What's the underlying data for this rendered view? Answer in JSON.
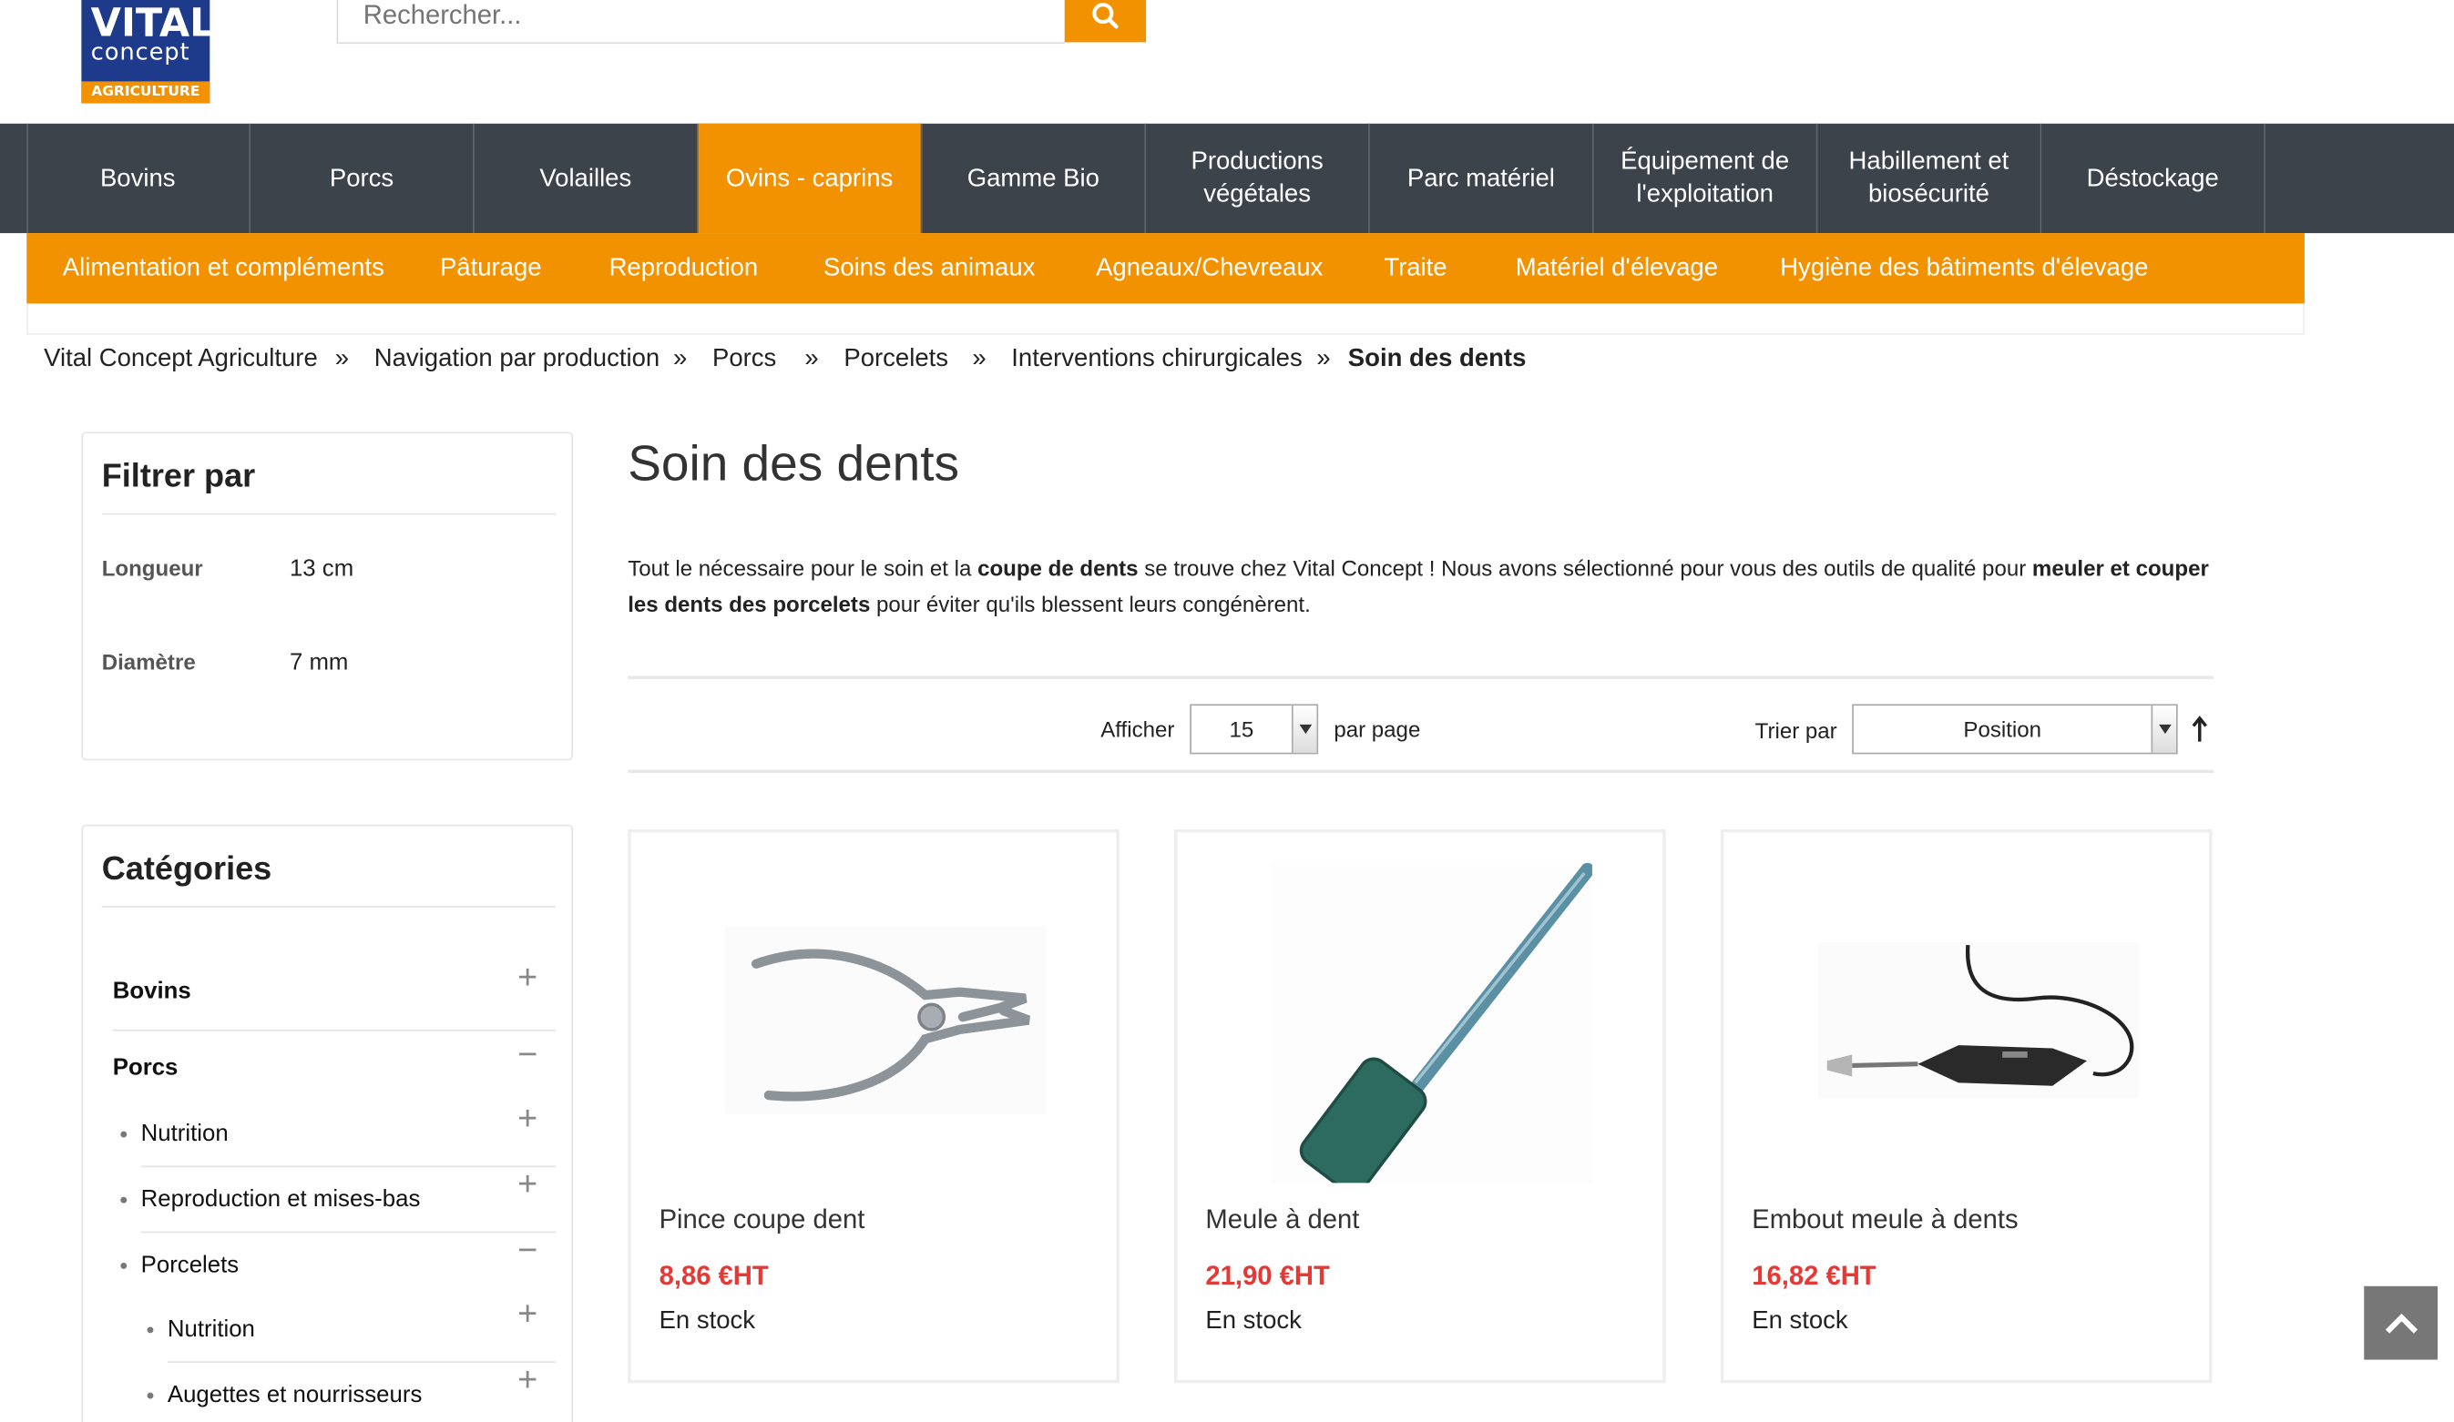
{
  "header": {
    "logo": {
      "line1": "VITAL",
      "line2": "concept",
      "line3": "AGRICULTURE"
    },
    "search": {
      "placeholder": "Rechercher...",
      "icon": "search-icon"
    }
  },
  "main_nav": [
    {
      "label": "Bovins"
    },
    {
      "label": "Porcs"
    },
    {
      "label": "Volailles"
    },
    {
      "label": "Ovins - caprins",
      "active": true
    },
    {
      "label": "Gamme Bio"
    },
    {
      "label": "Productions végétales"
    },
    {
      "label": "Parc matériel"
    },
    {
      "label": "Équipement de l'exploitation"
    },
    {
      "label": "Habillement et biosécurité"
    },
    {
      "label": "Déstockage"
    }
  ],
  "sub_nav": [
    "Alimentation et compléments",
    "Pâturage",
    "Reproduction",
    "Soins des animaux",
    "Agneaux/Chevreaux",
    "Traite",
    "Matériel d'élevage",
    "Hygiène des bâtiments d'élevage"
  ],
  "breadcrumb": {
    "separator": "»",
    "items": [
      "Vital Concept Agriculture",
      "Navigation par production",
      "Porcs",
      "Porcelets",
      "Interventions chirurgicales",
      "Soin des dents"
    ]
  },
  "filter": {
    "title": "Filtrer par",
    "rows": [
      {
        "label": "Longueur",
        "value": "13 cm"
      },
      {
        "label": "Diamètre",
        "value": "7 mm"
      }
    ]
  },
  "categories": {
    "title": "Catégories",
    "items": [
      {
        "label": "Bovins",
        "toggle": "+"
      },
      {
        "label": "Porcs",
        "toggle": "−"
      },
      {
        "label": "Nutrition",
        "toggle": "+"
      },
      {
        "label": "Reproduction et mises-bas",
        "toggle": "+"
      },
      {
        "label": "Porcelets",
        "toggle": "−"
      },
      {
        "label": "Nutrition",
        "toggle": "+"
      },
      {
        "label": "Augettes et nourrisseurs",
        "toggle": "+"
      }
    ]
  },
  "content": {
    "title": "Soin des dents",
    "description": {
      "p1": "Tout le nécessaire pour le soin et la ",
      "b1": "coupe de dents",
      "p2": " se trouve chez Vital Concept ! Nous avons sélectionné pour vous des outils de qualité pour ",
      "b2": "meuler et couper les dents des porcelets",
      "p3": " pour éviter qu'ils blessent leurs congénèrent."
    },
    "toolbar": {
      "show_label": "Afficher",
      "per_page_value": "15",
      "per_page_suffix": "par page",
      "sort_label": "Trier par",
      "sort_value": "Position",
      "sort_dir_icon": "arrow-up-icon"
    },
    "products": [
      {
        "name": "Pince coupe dent",
        "price": "8,86 €HT",
        "stock": "En stock",
        "image_icon": "pliers-icon"
      },
      {
        "name": "Meule à dent",
        "price": "21,90 €HT",
        "stock": "En stock",
        "image_icon": "grinding-stone-icon"
      },
      {
        "name": "Embout meule à dents",
        "price": "16,82 €HT",
        "stock": "En stock",
        "image_icon": "rotary-tool-icon"
      }
    ]
  },
  "back_to_top": {
    "icon": "chevron-up-icon"
  },
  "colors": {
    "accent": "#f39200",
    "nav_bg": "#3d434b",
    "price": "#e53935",
    "logo_blue": "#1e3a8a"
  }
}
